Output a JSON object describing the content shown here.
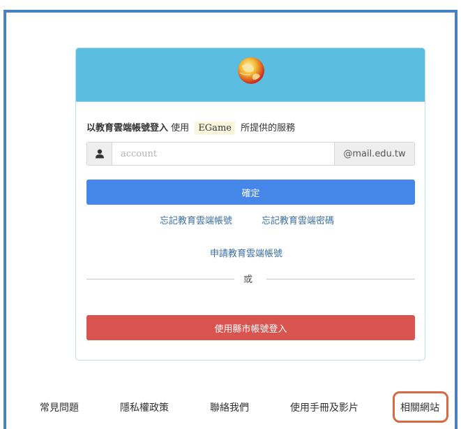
{
  "login": {
    "intro_prefix": "以教育雲端帳號登入",
    "intro_use": "使用",
    "service_name": "EGame",
    "intro_suffix": "所提供的服務",
    "account_placeholder": "account",
    "domain_suffix": "@mail.edu.tw",
    "confirm_label": "確定",
    "forgot_account": "忘記教育雲端帳號",
    "forgot_password": "忘記教育雲端密碼",
    "apply_account": "申請教育雲端帳號",
    "or_text": "或",
    "city_login_label": "使用縣市帳號登入"
  },
  "footer": {
    "faq": "常見問題",
    "privacy": "隱私權政策",
    "contact": "聯絡我們",
    "manual": "使用手冊及影片",
    "related_sites": "相關網站"
  },
  "colors": {
    "header": "#5bbee0",
    "primary_button": "#4487e9",
    "danger_button": "#d9534f",
    "highlight": "#d86a43",
    "frame": "#4a7fc0"
  },
  "icons": {
    "logo": "globe-icon",
    "user": "user-icon"
  }
}
